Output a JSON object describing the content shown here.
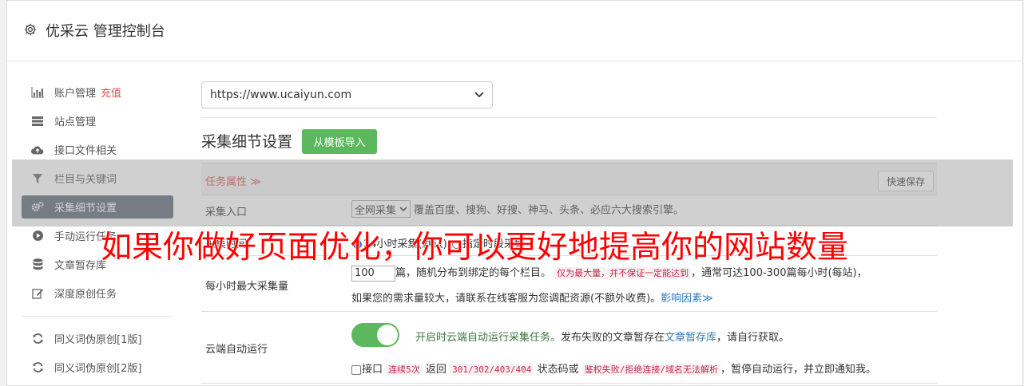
{
  "header": {
    "icon": "gear-icon",
    "title": "优采云 管理控制台"
  },
  "sidebar": {
    "items": [
      {
        "icon": "bar-chart-icon",
        "label": "账户管理",
        "badge": "充值"
      },
      {
        "icon": "server-icon",
        "label": "站点管理"
      },
      {
        "icon": "cloud-upload-icon",
        "label": "接口文件相关"
      },
      {
        "icon": "filter-icon",
        "label": "栏目与关键词"
      },
      {
        "icon": "gears-icon",
        "label": "采集细节设置"
      },
      {
        "icon": "play-icon",
        "label": "手动运行任务"
      },
      {
        "icon": "database-icon",
        "label": "文章暂存库"
      },
      {
        "icon": "edit-icon",
        "label": "深度原创任务"
      },
      {
        "icon": "refresh-icon",
        "label": "同义词伪原创[1版]"
      },
      {
        "icon": "refresh-icon",
        "label": "同义词伪原创[2版]"
      }
    ],
    "active_index": 4
  },
  "main": {
    "site_select": "https://www.ucaiyun.com",
    "section_title": "采集细节设置",
    "import_button": "从模板导入",
    "task_props_label": "任务属性 ≫",
    "quick_save_button": "快速保存",
    "rows": {
      "entry": {
        "label": "采集入口",
        "select": "全网采集",
        "desc": "覆盖百度、搜狗、好搜、神马、头条、必应六大搜索引擎。"
      },
      "timing": {
        "label": "采集时间",
        "option1": "24小时采集(默认)",
        "option2": "指定时段采集"
      },
      "max_per_hour": {
        "label": "每小时最大采集量",
        "value": "100",
        "text1": "篇，随机分布到绑定的每个栏目。",
        "code1": "仅为最大量，并不保证一定能达到",
        "text2": "，通常可达100-300篇每小时(每站)，",
        "text3": "如果您的需求量较大，请联系在线客服为您调配资源(不额外收费)。",
        "link": "影响因素"
      },
      "cloud_run": {
        "label": "云端自动运行",
        "toggle_text": "开启时云端自动运行采集任务。",
        "text1": "发布失败的文章暂存在",
        "link": "文章暂存库",
        "text2": "，请自行获取。",
        "chk_label": "接口",
        "code1": "连续5次",
        "text3": "返回",
        "code2": "301/302/403/404",
        "text4": "状态码或",
        "code3": "鉴权失败/拒绝连接/域名无法解析",
        "text5": "，暂停自动运行，并立即通知我。"
      }
    }
  },
  "overlay": {
    "watermark": "如果你做好页面优化，你可以更好地提高你的网站数量"
  },
  "colors": {
    "accent_green": "#5cb85c",
    "active_nav": "#5b6673",
    "watermark": "#ff0000",
    "code_red": "#c7254e"
  }
}
